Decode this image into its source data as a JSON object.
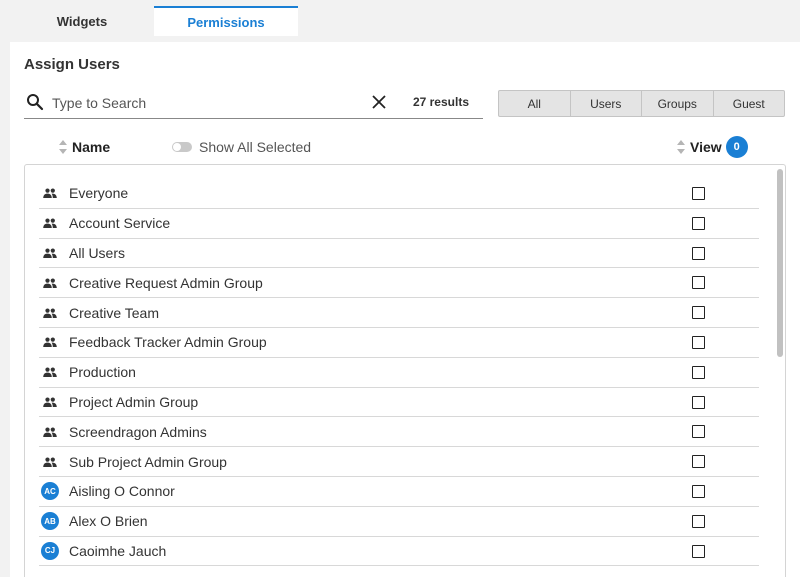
{
  "tabs": [
    {
      "label": "Widgets",
      "active": false
    },
    {
      "label": "Permissions",
      "active": true
    }
  ],
  "panel": {
    "title": "Assign Users"
  },
  "search": {
    "placeholder": "Type to Search",
    "value": "",
    "results_text": "27 results"
  },
  "filters": [
    "All",
    "Users",
    "Groups",
    "Guest"
  ],
  "columns": {
    "name": "Name",
    "show_all_selected": "Show All Selected",
    "show_all_selected_on": false,
    "view": "View",
    "view_count": "0"
  },
  "accent_color": "#1a7fd4",
  "rows": [
    {
      "type": "group",
      "icon": "group-icon",
      "label": "Everyone",
      "checked": false
    },
    {
      "type": "group",
      "icon": "group-icon",
      "label": "Account Service",
      "checked": false
    },
    {
      "type": "group",
      "icon": "group-icon",
      "label": "All Users",
      "checked": false
    },
    {
      "type": "group",
      "icon": "group-icon",
      "label": "Creative Request Admin Group",
      "checked": false
    },
    {
      "type": "group",
      "icon": "group-icon",
      "label": "Creative Team",
      "checked": false
    },
    {
      "type": "group",
      "icon": "group-icon",
      "label": "Feedback Tracker Admin Group",
      "checked": false
    },
    {
      "type": "group",
      "icon": "group-icon",
      "label": "Production",
      "checked": false
    },
    {
      "type": "group",
      "icon": "group-icon",
      "label": "Project Admin Group",
      "checked": false
    },
    {
      "type": "group",
      "icon": "group-icon",
      "label": "Screendragon Admins",
      "checked": false
    },
    {
      "type": "group",
      "icon": "group-icon",
      "label": "Sub Project Admin Group",
      "checked": false
    },
    {
      "type": "user",
      "initials": "AC",
      "label": "Aisling O Connor",
      "checked": false
    },
    {
      "type": "user",
      "initials": "AB",
      "label": "Alex O Brien",
      "checked": false
    },
    {
      "type": "user",
      "initials": "CJ",
      "label": "Caoimhe Jauch",
      "checked": false
    }
  ]
}
